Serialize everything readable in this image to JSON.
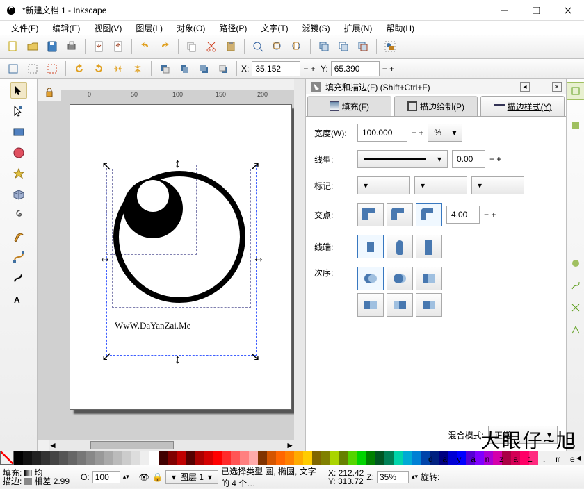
{
  "title": "*新建文档 1 - Inkscape",
  "menus": [
    "文件(F)",
    "编辑(E)",
    "视图(V)",
    "图层(L)",
    "对象(O)",
    "路径(P)",
    "文字(T)",
    "滤镜(S)",
    "扩展(N)",
    "帮助(H)"
  ],
  "coords": {
    "xlabel": "X:",
    "x": "35.152",
    "ylabel": "Y:",
    "y": "65.390"
  },
  "panel": {
    "title": "填充和描边(F) (Shift+Ctrl+F)",
    "tabs": {
      "fill": "填充(F)",
      "stroke_paint": "描边绘制(P)",
      "stroke_style": "描边样式(Y)"
    },
    "width_label": "宽度(W):",
    "width_val": "100.000",
    "unit": "%",
    "line_label": "线型:",
    "dash_offset": "0.00",
    "marker_label": "标记:",
    "join_label": "交点:",
    "miter": "4.00",
    "cap_label": "线端:",
    "order_label": "次序:",
    "blend_label": "混合模式:",
    "blend": "正常"
  },
  "canvas_text": "WwW.DaYanZai.Me",
  "statusbar": {
    "fill_label": "填充:",
    "fill_val": "均",
    "stroke_label": "描边:",
    "stroke_val": "相差 2.99",
    "o_label": "O:",
    "opacity": "100",
    "layer": "图层 1",
    "msg": "已选择类型 圆, 椭圆, 文字 的 4 个…",
    "x": "212.42",
    "y": "313.72",
    "z_label": "Z:",
    "z_val": "35%",
    "rotate_label": "旋转:"
  },
  "ruler": {
    "t0": "0",
    "t50": "50",
    "t100": "100",
    "t150": "150",
    "t200": "200"
  },
  "palette_colors": [
    "#000",
    "#111",
    "#222",
    "#333",
    "#444",
    "#555",
    "#666",
    "#777",
    "#888",
    "#999",
    "#aaa",
    "#bbb",
    "#ccc",
    "#ddd",
    "#eee",
    "#fff",
    "#400000",
    "#800000",
    "#c00000",
    "#550000",
    "#aa0000",
    "#d40000",
    "#ff0000",
    "#ff2a2a",
    "#ff5555",
    "#ff8080",
    "#ffaaaa",
    "#803300",
    "#d45500",
    "#ff6600",
    "#ff8000",
    "#ffaa00",
    "#ffcc00",
    "#806600",
    "#808000",
    "#aad400",
    "#668000",
    "#55d400",
    "#00d400",
    "#008000",
    "#005522",
    "#008055",
    "#00d4aa",
    "#00aad4",
    "#0080d4",
    "#0044aa",
    "#002080",
    "#000080",
    "#0000d4",
    "#0000ff",
    "#5500d4",
    "#8000ff",
    "#aa00d4",
    "#d400aa",
    "#aa0044",
    "#d40055",
    "#ff0066",
    "#ff2a7f"
  ]
}
